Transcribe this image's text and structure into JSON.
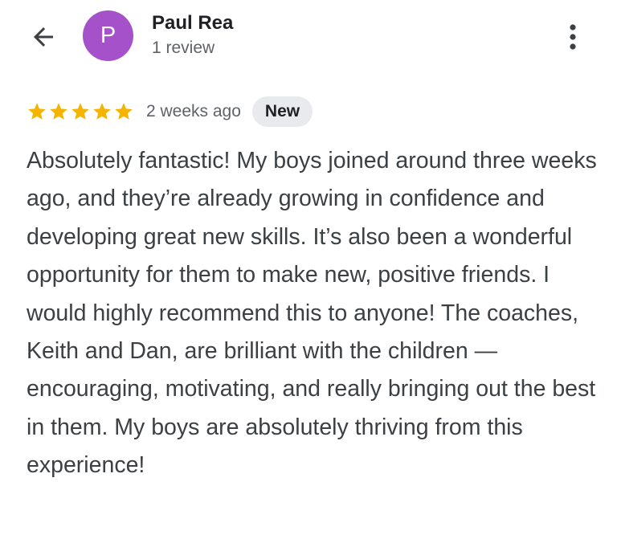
{
  "header": {
    "back_icon": "arrow-back-icon",
    "avatar_letter": "P",
    "avatar_color": "#a551c9",
    "user_name": "Paul Rea",
    "review_count": "1 review",
    "more_icon": "more-vert-icon"
  },
  "review": {
    "rating": 5,
    "max_rating": 5,
    "star_color": "#f4b400",
    "date": "2 weeks ago",
    "badge": "New",
    "text": "Absolutely fantastic! My boys joined around three weeks ago, and they’re already growing in confidence and developing great new skills. It’s also been a wonderful opportunity for them to make new, positive friends. I would highly recommend this to anyone! The coaches, Keith and Dan, are brilliant with the children — encouraging, motivating, and really bringing out the best in them. My boys are absolutely thriving from this experience!"
  }
}
